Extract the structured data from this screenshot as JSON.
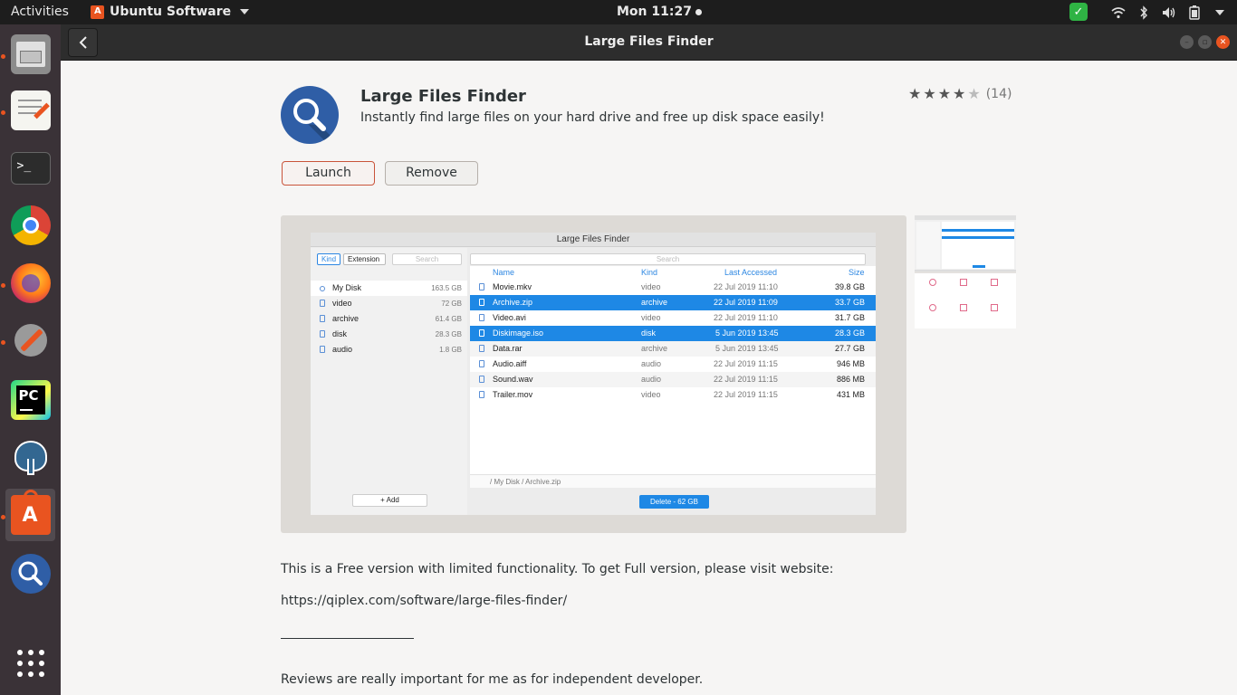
{
  "topbar": {
    "activities": "Activities",
    "app_menu": "Ubuntu Software",
    "clock": "Mon 11:27"
  },
  "dock": {
    "items": [
      {
        "name": "files"
      },
      {
        "name": "text-editor"
      },
      {
        "name": "terminal"
      },
      {
        "name": "chrome"
      },
      {
        "name": "firefox"
      },
      {
        "name": "system-tools"
      },
      {
        "name": "pycharm"
      },
      {
        "name": "pgadmin"
      },
      {
        "name": "ubuntu-software"
      },
      {
        "name": "large-files-finder"
      }
    ]
  },
  "headerbar": {
    "title": "Large Files Finder"
  },
  "app": {
    "name": "Large Files Finder",
    "summary": "Instantly find large files on your hard drive and free up disk space easily!",
    "rating_stars": 4,
    "rating_count": "(14)",
    "launch_label": "Launch",
    "remove_label": "Remove"
  },
  "screenshot": {
    "window_title": "Large Files Finder",
    "seg_kind": "Kind",
    "seg_extension": "Extension",
    "search_placeholder": "Search",
    "left_rows": [
      {
        "name": "My Disk",
        "size": "163.5 GB"
      },
      {
        "name": "video",
        "size": "72 GB"
      },
      {
        "name": "archive",
        "size": "61.4 GB"
      },
      {
        "name": "disk",
        "size": "28.3 GB"
      },
      {
        "name": "audio",
        "size": "1.8 GB"
      }
    ],
    "add_label": "+ Add",
    "columns": [
      "Name",
      "Kind",
      "Last Accessed",
      "Size"
    ],
    "files": [
      {
        "name": "Movie.mkv",
        "kind": "video",
        "accessed": "22 Jul 2019 11:10",
        "size": "39.8 GB"
      },
      {
        "name": "Archive.zip",
        "kind": "archive",
        "accessed": "22 Jul 2019 11:09",
        "size": "33.7 GB"
      },
      {
        "name": "Video.avi",
        "kind": "video",
        "accessed": "22 Jul 2019 11:10",
        "size": "31.7 GB"
      },
      {
        "name": "Diskimage.iso",
        "kind": "disk",
        "accessed": "5 Jun 2019 13:45",
        "size": "28.3 GB"
      },
      {
        "name": "Data.rar",
        "kind": "archive",
        "accessed": "5 Jun 2019 13:45",
        "size": "27.7 GB"
      },
      {
        "name": "Audio.aiff",
        "kind": "audio",
        "accessed": "22 Jul 2019 11:15",
        "size": "946 MB"
      },
      {
        "name": "Sound.wav",
        "kind": "audio",
        "accessed": "22 Jul 2019 11:15",
        "size": "886 MB"
      },
      {
        "name": "Trailer.mov",
        "kind": "video",
        "accessed": "22 Jul 2019 11:15",
        "size": "431 MB"
      }
    ],
    "path": "/ My Disk / Archive.zip",
    "delete_label": "Delete - 62 GB"
  },
  "description": {
    "line1": "This is a Free version with limited functionality. To get Full version, please visit website:",
    "line2": "https://qiplex.com/software/large-files-finder/",
    "line3": "Reviews are really important for me as for independent developer."
  },
  "colors": {
    "accent": "#e95420",
    "selection": "#1e88e5",
    "topbar": "#1d1d1d",
    "dock": "#3a3237"
  }
}
